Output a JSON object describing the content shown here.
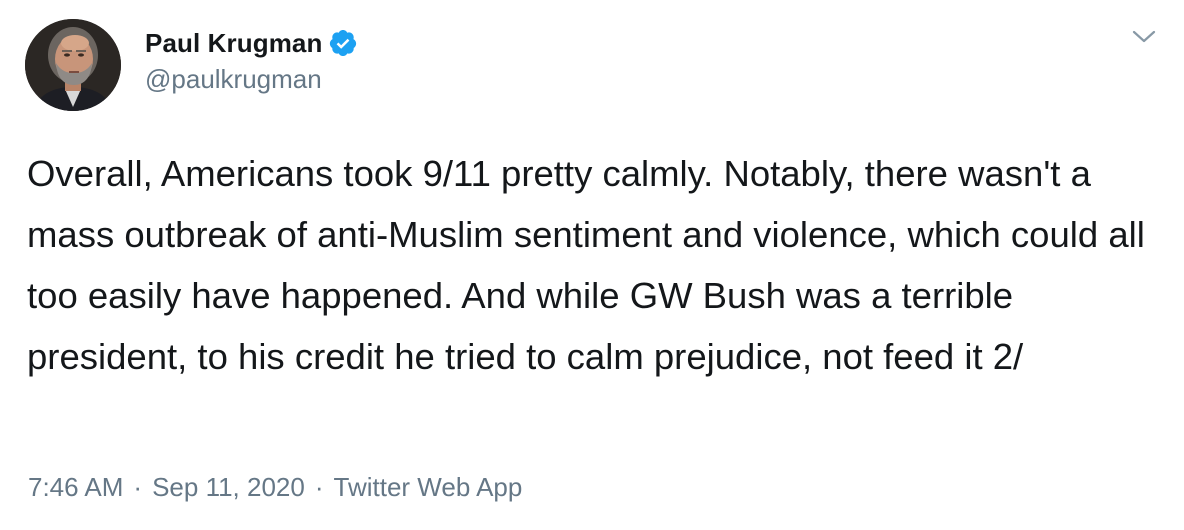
{
  "author": {
    "display_name": "Paul Krugman",
    "handle": "@paulkrugman",
    "verified": true,
    "verified_color": "#1da1f2"
  },
  "tweet": {
    "text": "Overall, Americans took 9/11 pretty calmly. Notably, there wasn't a mass outbreak of anti-Muslim sentiment and violence, which could all too easily have happened. And while GW Bush was a terrible president, to his credit he tried to calm prejudice, not feed it 2/"
  },
  "meta": {
    "time": "7:46 AM",
    "separator": "·",
    "date": "Sep 11, 2020",
    "source": "Twitter Web App"
  },
  "icons": {
    "verified": "verified-badge-icon",
    "menu": "chevron-down-icon"
  },
  "colors": {
    "text": "#14171a",
    "secondary": "#657786",
    "background": "#ffffff"
  }
}
